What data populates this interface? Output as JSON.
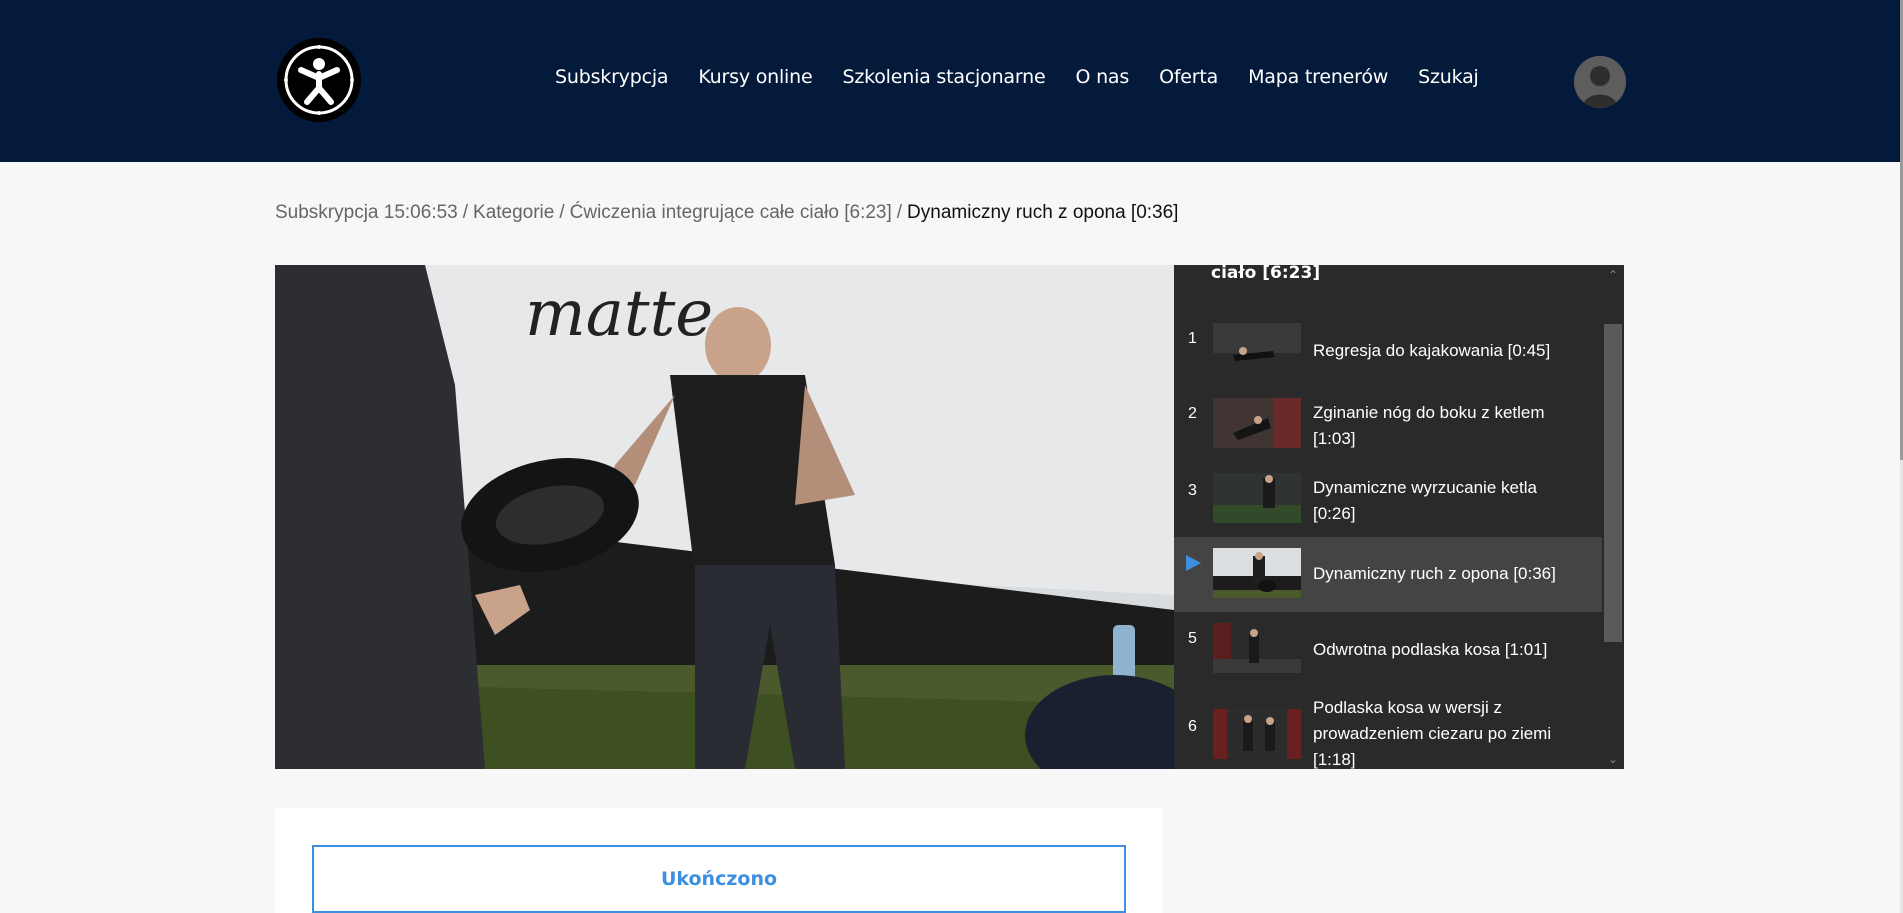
{
  "header": {
    "nav": [
      {
        "label": "Subskrypcja"
      },
      {
        "label": "Kursy online"
      },
      {
        "label": "Szkolenia stacjonarne"
      },
      {
        "label": "O nas"
      },
      {
        "label": "Oferta"
      },
      {
        "label": "Mapa trenerów"
      },
      {
        "label": "Szukaj"
      }
    ]
  },
  "breadcrumb": {
    "items": [
      {
        "label": "Subskrypcja 15:06:53"
      },
      {
        "label": "Kategorie"
      },
      {
        "label": "Ćwiczenia integrujące całe ciało [6:23]"
      }
    ],
    "separator": "/",
    "current": "Dynamiczny ruch z opona [0:36]"
  },
  "playlist": {
    "title": "ciało [6:23]",
    "items": [
      {
        "num": "1",
        "label": "Regresja do kajakowania [0:45]",
        "active": false
      },
      {
        "num": "2",
        "label": "Zginanie nóg do boku z ketlem [1:03]",
        "active": false
      },
      {
        "num": "3",
        "label": "Dynamiczne wyrzucanie ketla [0:26]",
        "active": false
      },
      {
        "num": "4",
        "label": "Dynamiczny ruch z opona [0:36]",
        "active": true
      },
      {
        "num": "5",
        "label": "Odwrotna podlaska kosa [1:01]",
        "active": false
      },
      {
        "num": "6",
        "label": "Podlaska kosa w wersji z prowadzeniem ciezaru po ziemi [1:18]",
        "active": false
      }
    ]
  },
  "completed_button": {
    "label": "Ukończono"
  },
  "colors": {
    "header_bg": "#041a3b",
    "accent": "#3d8fe0",
    "playlist_bg": "#2a2a2a"
  },
  "icons": {
    "logo": "vitruvian-figure-logo",
    "avatar": "user-avatar-icon",
    "play": "play-triangle-icon"
  }
}
